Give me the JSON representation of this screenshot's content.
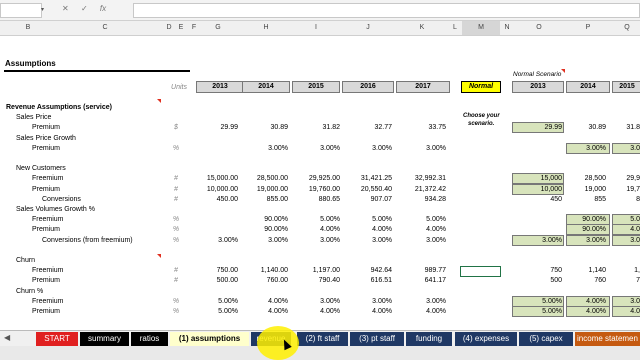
{
  "formula_bar": {
    "dropdown_glyph": "▾",
    "cancel_glyph": "✕",
    "enter_glyph": "✓",
    "fx_label": "fx"
  },
  "columns": [
    "B",
    "C",
    "D",
    "E",
    "F",
    "G",
    "H",
    "I",
    "J",
    "K",
    "L",
    "M",
    "N",
    "O",
    "P",
    "Q"
  ],
  "sheet": {
    "title": "Assumptions",
    "units_header": "Units",
    "normal_scenario_label": "Normal Scenario",
    "scenario_value": "Normal",
    "choose_note_1": "Choose your",
    "choose_note_2": "scenario.",
    "years_left": [
      "2013",
      "2014",
      "2015",
      "2016",
      "2017"
    ],
    "years_right": [
      "2013",
      "2014",
      "2015"
    ],
    "rows": [
      {
        "label": "Revenue Assumptions (service)",
        "indent": 0,
        "bold": true,
        "unit": "",
        "vals": [
          "",
          "",
          "",
          "",
          ""
        ],
        "rvals": [
          "",
          "",
          ""
        ]
      },
      {
        "label": "Sales Price",
        "indent": 1,
        "unit": "",
        "vals": [
          "",
          "",
          "",
          "",
          ""
        ],
        "rvals": [
          "",
          "",
          ""
        ]
      },
      {
        "label": "Premium",
        "indent": 2,
        "unit": "$",
        "vals": [
          "29.99",
          "30.89",
          "31.82",
          "32.77",
          "33.75"
        ],
        "rvals": [
          "29.99",
          "30.89",
          "31.8"
        ]
      },
      {
        "label": "Sales Price Growth",
        "indent": 1,
        "unit": "",
        "vals": [
          "",
          "",
          "",
          "",
          ""
        ],
        "rvals": [
          "",
          "",
          ""
        ]
      },
      {
        "label": "Premium",
        "indent": 2,
        "unit": "%",
        "vals": [
          "",
          "3.00%",
          "3.00%",
          "3.00%",
          "3.00%"
        ],
        "rvals": [
          "",
          "3.00%",
          "3.0"
        ]
      },
      {
        "label": "",
        "indent": 0,
        "unit": "",
        "vals": [
          "",
          "",
          "",
          "",
          ""
        ],
        "rvals": [
          "",
          "",
          ""
        ]
      },
      {
        "label": "New Customers",
        "indent": 1,
        "unit": "",
        "vals": [
          "",
          "",
          "",
          "",
          ""
        ],
        "rvals": [
          "",
          "",
          ""
        ]
      },
      {
        "label": "Freemium",
        "indent": 2,
        "unit": "#",
        "vals": [
          "15,000.00",
          "28,500.00",
          "29,925.00",
          "31,421.25",
          "32,992.31"
        ],
        "rvals": [
          "15,000",
          "28,500",
          "29,9"
        ]
      },
      {
        "label": "Premium",
        "indent": 2,
        "unit": "#",
        "vals": [
          "10,000.00",
          "19,000.00",
          "19,760.00",
          "20,550.40",
          "21,372.42"
        ],
        "rvals": [
          "10,000",
          "19,000",
          "19,7"
        ]
      },
      {
        "label": "Conversions",
        "indent": 3,
        "unit": "#",
        "vals": [
          "450.00",
          "855.00",
          "880.65",
          "907.07",
          "934.28"
        ],
        "rvals": [
          "450",
          "855",
          "8"
        ]
      },
      {
        "label": "Sales Volumes Growth %",
        "indent": 1,
        "unit": "",
        "vals": [
          "",
          "",
          "",
          "",
          ""
        ],
        "rvals": [
          "",
          "",
          ""
        ]
      },
      {
        "label": "Freemium",
        "indent": 2,
        "unit": "%",
        "vals": [
          "",
          "90.00%",
          "5.00%",
          "5.00%",
          "5.00%"
        ],
        "rvals": [
          "",
          "90.00%",
          "5.0"
        ]
      },
      {
        "label": "Premium",
        "indent": 2,
        "unit": "%",
        "vals": [
          "",
          "90.00%",
          "4.00%",
          "4.00%",
          "4.00%"
        ],
        "rvals": [
          "",
          "90.00%",
          "4.0"
        ]
      },
      {
        "label": "Conversions (from freemium)",
        "indent": 3,
        "unit": "%",
        "vals": [
          "3.00%",
          "3.00%",
          "3.00%",
          "3.00%",
          "3.00%"
        ],
        "rvals": [
          "3.00%",
          "3.00%",
          "3.0"
        ]
      },
      {
        "label": "",
        "indent": 0,
        "unit": "",
        "vals": [
          "",
          "",
          "",
          "",
          ""
        ],
        "rvals": [
          "",
          "",
          ""
        ]
      },
      {
        "label": "Churn",
        "indent": 1,
        "unit": "",
        "vals": [
          "",
          "",
          "",
          "",
          ""
        ],
        "rvals": [
          "",
          "",
          ""
        ]
      },
      {
        "label": "Freemium",
        "indent": 2,
        "unit": "#",
        "vals": [
          "750.00",
          "1,140.00",
          "1,197.00",
          "942.64",
          "989.77"
        ],
        "rvals": [
          "750",
          "1,140",
          "1,"
        ]
      },
      {
        "label": "Premium",
        "indent": 2,
        "unit": "#",
        "vals": [
          "500.00",
          "760.00",
          "790.40",
          "616.51",
          "641.17"
        ],
        "rvals": [
          "500",
          "760",
          "7"
        ]
      },
      {
        "label": "Churn %",
        "indent": 1,
        "unit": "",
        "vals": [
          "",
          "",
          "",
          "",
          ""
        ],
        "rvals": [
          "",
          "",
          ""
        ]
      },
      {
        "label": "Freemium",
        "indent": 2,
        "unit": "%",
        "vals": [
          "5.00%",
          "4.00%",
          "3.00%",
          "3.00%",
          "3.00%"
        ],
        "rvals": [
          "5.00%",
          "4.00%",
          "3.0"
        ]
      },
      {
        "label": "Premium",
        "indent": 2,
        "unit": "%",
        "vals": [
          "5.00%",
          "4.00%",
          "4.00%",
          "4.00%",
          "4.00%"
        ],
        "rvals": [
          "5.00%",
          "4.00%",
          "4.0"
        ]
      }
    ]
  },
  "tabs": [
    {
      "label": "START",
      "bg": "#e02020",
      "fg": "#ffffff"
    },
    {
      "label": "summary",
      "bg": "#000000",
      "fg": "#ffffff"
    },
    {
      "label": "ratios",
      "bg": "#000000",
      "fg": "#ffffff"
    },
    {
      "label": "(1) assumptions",
      "bg": "#ffffcc",
      "fg": "#000000",
      "active": true
    },
    {
      "label": "revenue",
      "bg": "#1f3864",
      "fg": "#ffffff"
    },
    {
      "label": "(2) ft staff",
      "bg": "#1f3864",
      "fg": "#ffffff"
    },
    {
      "label": "(3) pt staff",
      "bg": "#1f3864",
      "fg": "#ffffff"
    },
    {
      "label": "funding",
      "bg": "#1f3864",
      "fg": "#ffffff"
    },
    {
      "label": "(4) expenses",
      "bg": "#1f3864",
      "fg": "#ffffff"
    },
    {
      "label": "(5) capex",
      "bg": "#1f3864",
      "fg": "#ffffff"
    },
    {
      "label": "income statemen",
      "bg": "#c55a11",
      "fg": "#ffffff"
    }
  ],
  "nav_arrow": "◀"
}
